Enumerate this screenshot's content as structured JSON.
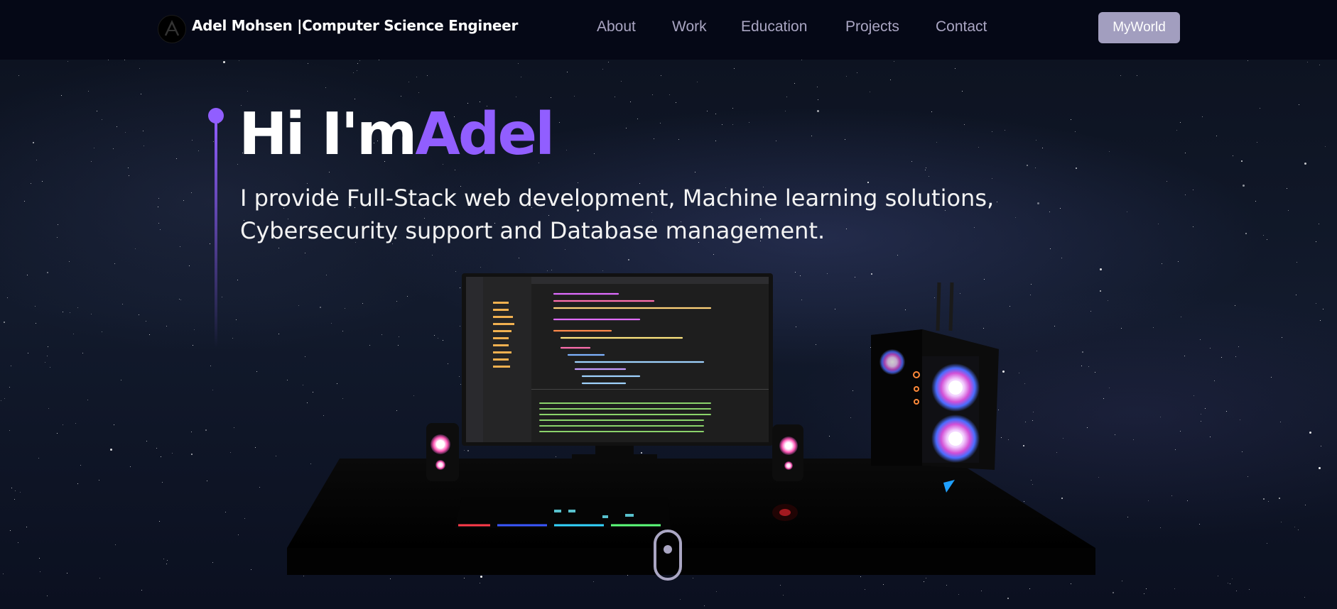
{
  "navbar": {
    "brand": "Adel Mohsen  |Computer Science Engineer",
    "links": [
      "About",
      "Work",
      "Education",
      "Projects",
      "Contact"
    ],
    "button_label": "MyWorld"
  },
  "hero": {
    "greeting": "Hi I'm",
    "name": "Adel",
    "subtitle_line1": "I provide Full-Stack web development, Machine learning solutions,",
    "subtitle_line2": "Cybersecurity support and Database management."
  },
  "colors": {
    "accent": "#915eff",
    "nav_bg": "#050816",
    "nav_link": "#aaa6c3",
    "button_bg": "#a29ebf"
  },
  "icons": [
    "logo-icon",
    "scroll-down-icon"
  ]
}
